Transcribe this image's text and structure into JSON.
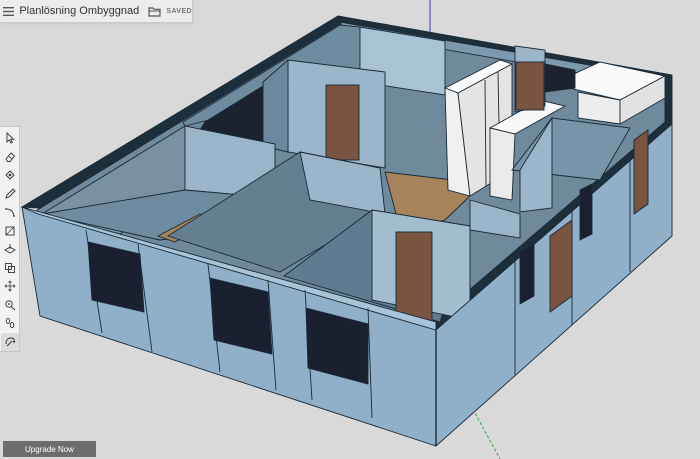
{
  "app": {
    "doc_title": "Planlösning Ombyggnad",
    "save_status": "SAVED",
    "upgrade_label": "Upgrade Now"
  },
  "toolbar": {
    "tools": [
      {
        "name": "select-tool",
        "icon": "arrow-cursor-icon"
      },
      {
        "name": "eraser-tool",
        "icon": "eraser-icon"
      },
      {
        "name": "paint-bucket-tool",
        "icon": "paint-bucket-icon"
      },
      {
        "name": "pencil-line-tool",
        "icon": "pencil-icon"
      },
      {
        "name": "arc-tool",
        "icon": "arc-icon"
      },
      {
        "name": "rectangle-tool",
        "icon": "rectangle-icon"
      },
      {
        "name": "push-pull-tool",
        "icon": "push-pull-icon"
      },
      {
        "name": "offset-tool",
        "icon": "offset-icon"
      },
      {
        "name": "move-tool",
        "icon": "move-arrows-icon"
      },
      {
        "name": "tape-measure-tool",
        "icon": "tape-measure-icon"
      },
      {
        "name": "footprints-tool",
        "icon": "footprints-icon"
      },
      {
        "name": "orbit-tool",
        "icon": "orbit-icon",
        "active": true
      }
    ]
  },
  "colors": {
    "background": "#d9d9d9",
    "wall_outer": "#8fb0c8",
    "wall_top": "#1e2f3c",
    "window": "#1a2030",
    "door": "#7a5440",
    "floor_opening": "#a6835a",
    "cabinets": "#f4f4f4",
    "axis_blue": "#3a3acf",
    "axis_green": "#3aa84a"
  }
}
